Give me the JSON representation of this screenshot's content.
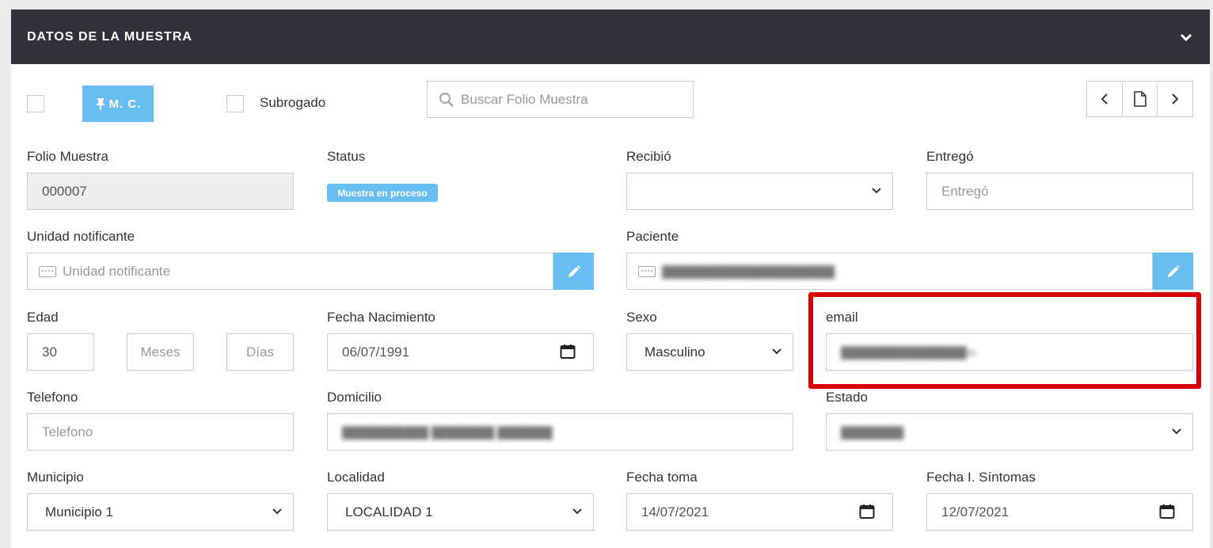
{
  "panel": {
    "title": "DATOS DE LA MUESTRA"
  },
  "toolbar": {
    "mc_label": "M. C.",
    "subrogado_label": "Subrogado",
    "search_placeholder": "Buscar Folio Muestra"
  },
  "fields": {
    "folio": {
      "label": "Folio Muestra",
      "value": "000007"
    },
    "status": {
      "label": "Status",
      "badge": "Muestra en proceso"
    },
    "recibio": {
      "label": "Recibió",
      "value": ""
    },
    "entrego": {
      "label": "Entregó",
      "placeholder": "Entregó"
    },
    "unidad": {
      "label": "Unidad notificante",
      "placeholder": "Unidad notificante"
    },
    "paciente": {
      "label": "Paciente",
      "value": "██████████████████████"
    },
    "edad": {
      "label": "Edad",
      "value": "30",
      "meses_placeholder": "Meses",
      "dias_placeholder": "Días"
    },
    "fecha_nacimiento": {
      "label": "Fecha Nacimiento",
      "value": "06/07/1991"
    },
    "sexo": {
      "label": "Sexo",
      "value": "Masculino"
    },
    "email": {
      "label": "email",
      "value": "████████████████m"
    },
    "telefono": {
      "label": "Telefono",
      "placeholder": "Telefono"
    },
    "domicilio": {
      "label": "Domicilio",
      "value": "███████████ ████████ ███████"
    },
    "estado": {
      "label": "Estado",
      "value": "████████"
    },
    "municipio": {
      "label": "Municipio",
      "value": "Municipio 1"
    },
    "localidad": {
      "label": "Localidad",
      "value": "LOCALIDAD 1"
    },
    "fecha_toma": {
      "label": "Fecha toma",
      "value": "14/07/2021"
    },
    "fecha_sintomas": {
      "label": "Fecha I. Síntomas",
      "value": "12/07/2021"
    }
  },
  "colors": {
    "header": "#30313b",
    "accent": "#68bdf3",
    "highlight": "#d90000"
  },
  "icons": [
    "chevron-down-icon",
    "pin-icon",
    "search-icon",
    "chevron-left-icon",
    "document-icon",
    "chevron-right-icon",
    "pencil-icon",
    "keyboard-icon",
    "calendar-icon"
  ]
}
